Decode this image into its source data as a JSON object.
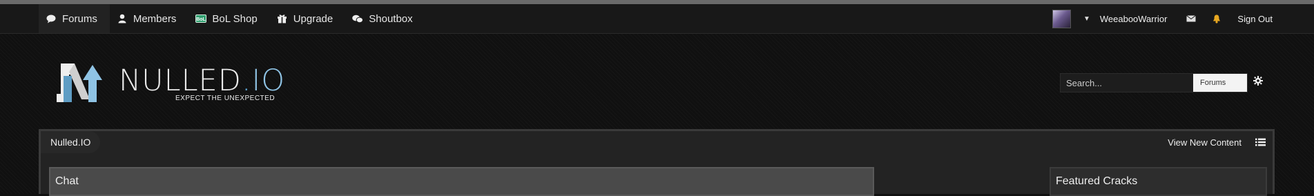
{
  "nav": {
    "items": [
      {
        "label": "Forums",
        "icon": "speech-bubble-icon",
        "active": true
      },
      {
        "label": "Members",
        "icon": "user-icon"
      },
      {
        "label": "BoL Shop",
        "icon": "bol-icon"
      },
      {
        "label": "Upgrade",
        "icon": "gift-icon"
      },
      {
        "label": "Shoutbox",
        "icon": "chat-bubbles-icon"
      }
    ]
  },
  "user": {
    "username": "WeeabooWarrior",
    "sign_out": "Sign Out",
    "avatar": "anime-avatar"
  },
  "logo": {
    "name": "NULLED",
    "dot": ".",
    "tld": "IO",
    "tagline": "EXPECT THE UNEXPECTED"
  },
  "search": {
    "placeholder": "Search...",
    "scope": "Forums"
  },
  "breadcrumb": {
    "label": "Nulled.IO"
  },
  "actions": {
    "view_new": "View New Content"
  },
  "panels": {
    "chat_title": "Chat",
    "featured_title": "Featured Cracks"
  },
  "colors": {
    "accent": "#8fc3e4",
    "bol_icon": "#2f9e6e"
  }
}
